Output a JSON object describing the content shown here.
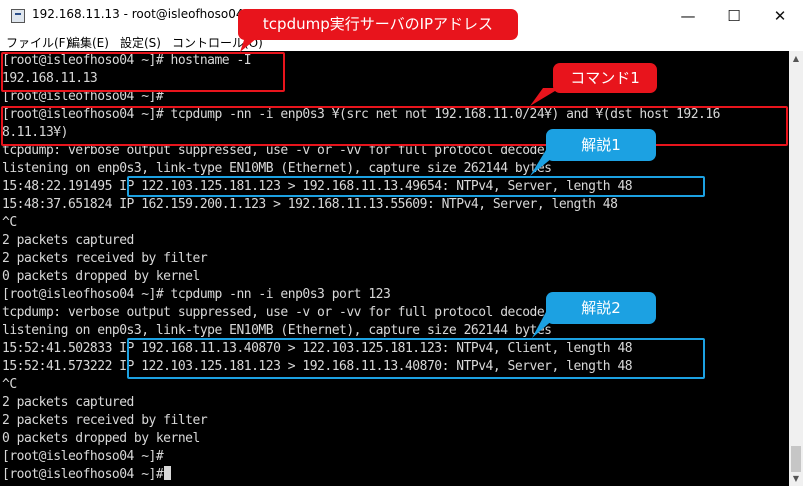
{
  "window": {
    "title": "192.168.11.13 - root@isleofhoso04:~ VT",
    "minimize_glyph": "—",
    "maximize_glyph": "☐",
    "close_glyph": "✕"
  },
  "menu": [
    "ファイル(F)",
    "編集(E)",
    "設定(S)",
    "コントロール(O)"
  ],
  "terminal_lines": [
    "[root@isleofhoso04 ~]# hostname -I",
    "192.168.11.13",
    "[root@isleofhoso04 ~]#",
    "[root@isleofhoso04 ~]# tcpdump -nn -i enp0s3 ¥(src net not 192.168.11.0/24¥) and ¥(dst host 192.16",
    "8.11.13¥)",
    "tcpdump: verbose output suppressed, use -v or -vv for full protocol decode",
    "listening on enp0s3, link-type EN10MB (Ethernet), capture size 262144 bytes",
    "15:48:22.191495 IP 122.103.125.181.123 > 192.168.11.13.49654: NTPv4, Server, length 48",
    "15:48:37.651824 IP 162.159.200.1.123 > 192.168.11.13.55609: NTPv4, Server, length 48",
    "^C",
    "2 packets captured",
    "2 packets received by filter",
    "0 packets dropped by kernel",
    "[root@isleofhoso04 ~]# tcpdump -nn -i enp0s3 port 123",
    "tcpdump: verbose output suppressed, use -v or -vv for full protocol decode",
    "listening on enp0s3, link-type EN10MB (Ethernet), capture size 262144 bytes",
    "15:52:41.502833 IP 192.168.11.13.40870 > 122.103.125.181.123: NTPv4, Client, length 48",
    "15:52:41.573222 IP 122.103.125.181.123 > 192.168.11.13.40870: NTPv4, Server, length 48",
    "^C",
    "2 packets captured",
    "2 packets received by filter",
    "0 packets dropped by kernel",
    "[root@isleofhoso04 ~]#",
    "[root@isleofhoso04 ~]#"
  ],
  "annotations": {
    "ip_address_note": "tcpdump実行サーバのIPアドレス",
    "command_note": "コマンド1",
    "explanation_1": "解説1",
    "explanation_2": "解説2"
  },
  "colors": {
    "annotation_red": "#e8141c",
    "annotation_blue": "#1ca1e2",
    "terminal_bg": "#000000",
    "terminal_fg": "#d8d8d8"
  },
  "icons": {
    "app": "terminal-app-icon",
    "scroll_up": "scroll-up-arrow-icon",
    "scroll_down": "scroll-down-arrow-icon"
  }
}
